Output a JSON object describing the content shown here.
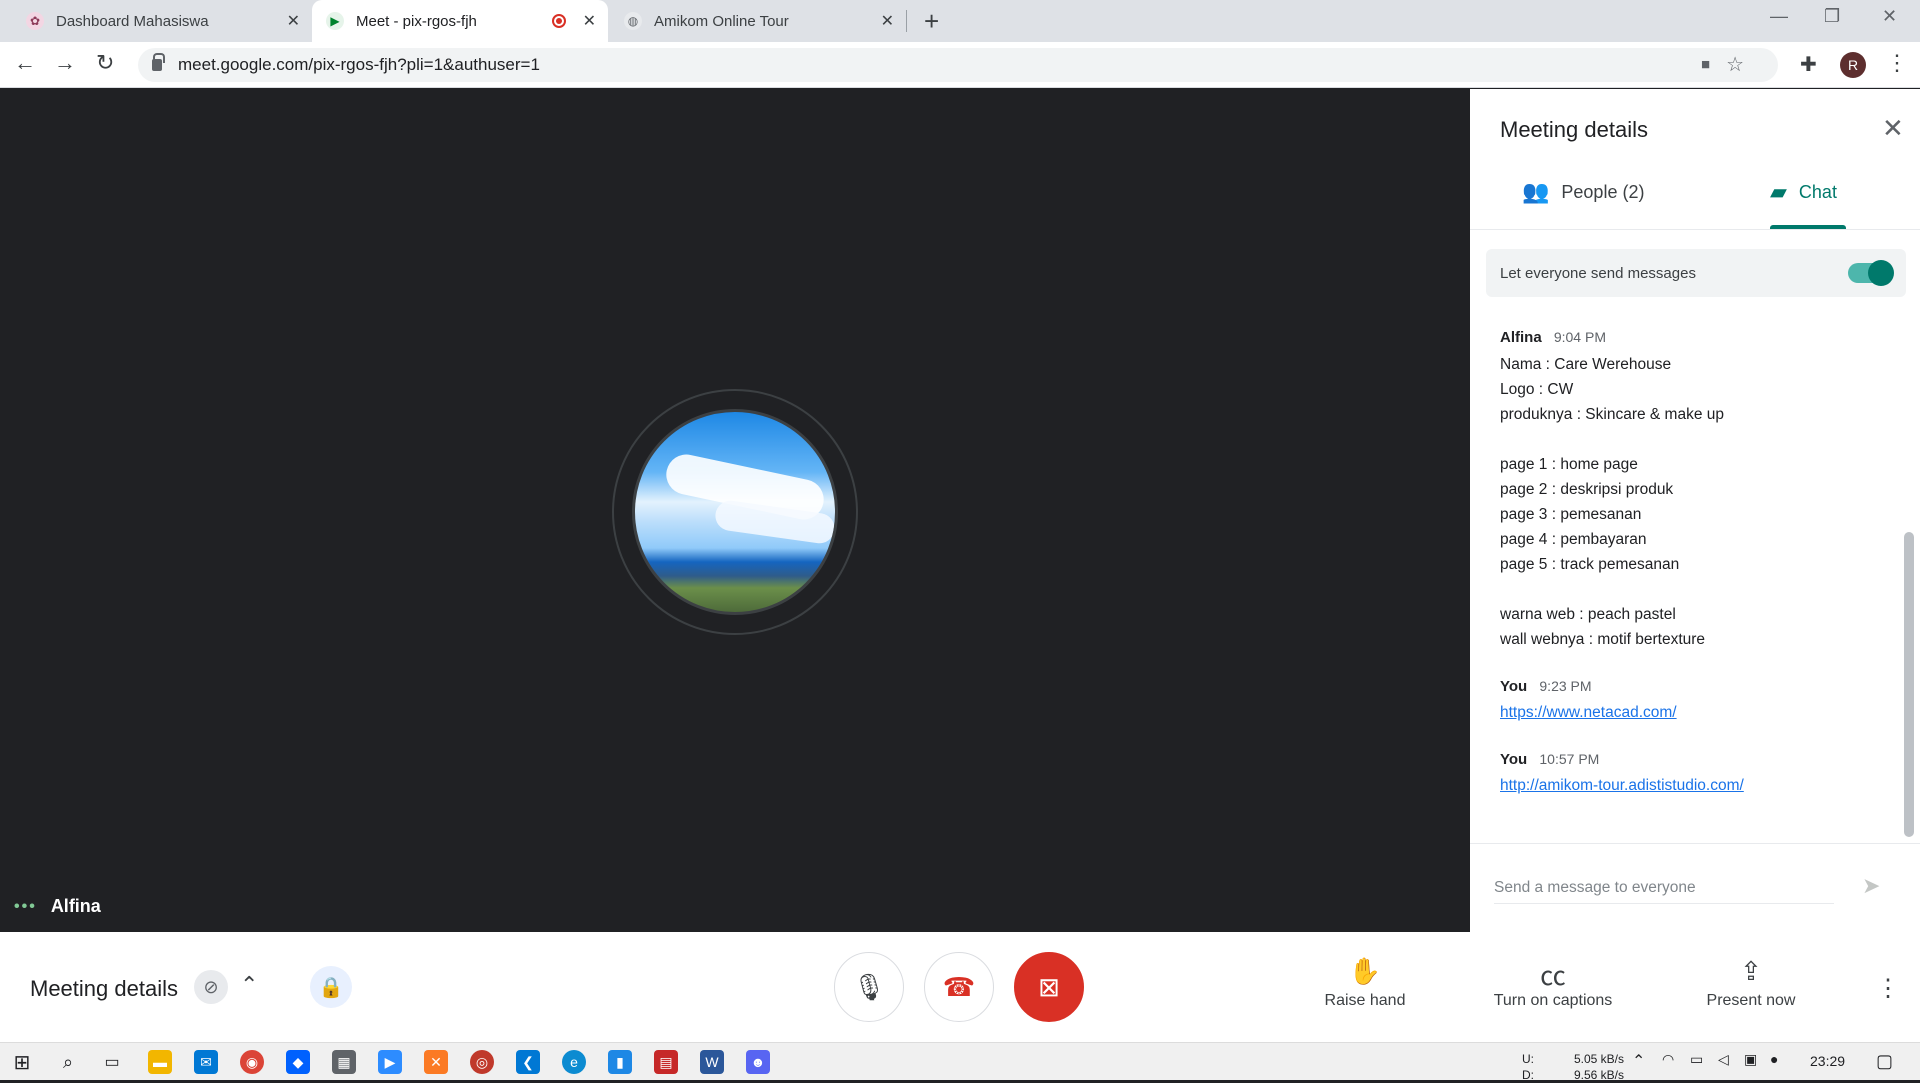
{
  "browser": {
    "tabs": [
      {
        "title": "Dashboard Mahasiswa",
        "favicon": "dashboard-icon",
        "color": "#8e3b5a"
      },
      {
        "title": "Meet - pix-rgos-fjh",
        "favicon": "meet-icon",
        "color": "#00832d",
        "active": true
      },
      {
        "title": "Amikom Online Tour",
        "favicon": "globe-icon",
        "color": "#5f6368"
      }
    ],
    "url": "meet.google.com/pix-rgos-fjh?pli=1&authuser=1",
    "profile_initial": "R"
  },
  "stage": {
    "participant_name": "Alfina"
  },
  "panel": {
    "title": "Meeting details",
    "tabs": [
      {
        "label": "People (2)",
        "icon": "people-icon"
      },
      {
        "label": "Chat",
        "icon": "chat-icon",
        "active": true
      }
    ],
    "toggle_label": "Let everyone send messages",
    "toggle_on": true,
    "messages": [
      {
        "sender": "Alfina",
        "time": "9:04 PM",
        "lines": [
          "Nama : Care Werehouse",
          "Logo : CW",
          "produknya : Skincare & make up",
          "",
          "page 1 : home page",
          "page 2 : deskripsi produk",
          "page 3 : pemesanan",
          "page 4 : pembayaran",
          "page 5 : track pemesanan",
          "",
          "warna web : peach pastel",
          "wall webnya : motif bertexture"
        ]
      },
      {
        "sender": "You",
        "time": "9:23 PM",
        "link": "https://www.netacad.com/"
      },
      {
        "sender": "You",
        "time": "10:57 PM",
        "link": "http://amikom-tour.adististudio.com/"
      }
    ],
    "send_placeholder": "Send a message to everyone"
  },
  "bottom": {
    "meeting_details_label": "Meeting details",
    "actions": [
      {
        "label": "Raise hand",
        "icon": "hand-icon"
      },
      {
        "label": "Turn on captions",
        "icon": "captions-icon"
      },
      {
        "label": "Present now",
        "icon": "present-icon"
      }
    ]
  },
  "taskbar": {
    "upload_label": "U:",
    "download_label": "D:",
    "upload_speed": "5.05 kB/s",
    "download_speed": "9.56 kB/s",
    "time": "23:29"
  },
  "colors": {
    "accent": "#00796b",
    "danger": "#d93025",
    "link": "#1a73e8",
    "stage_bg": "#202124"
  }
}
